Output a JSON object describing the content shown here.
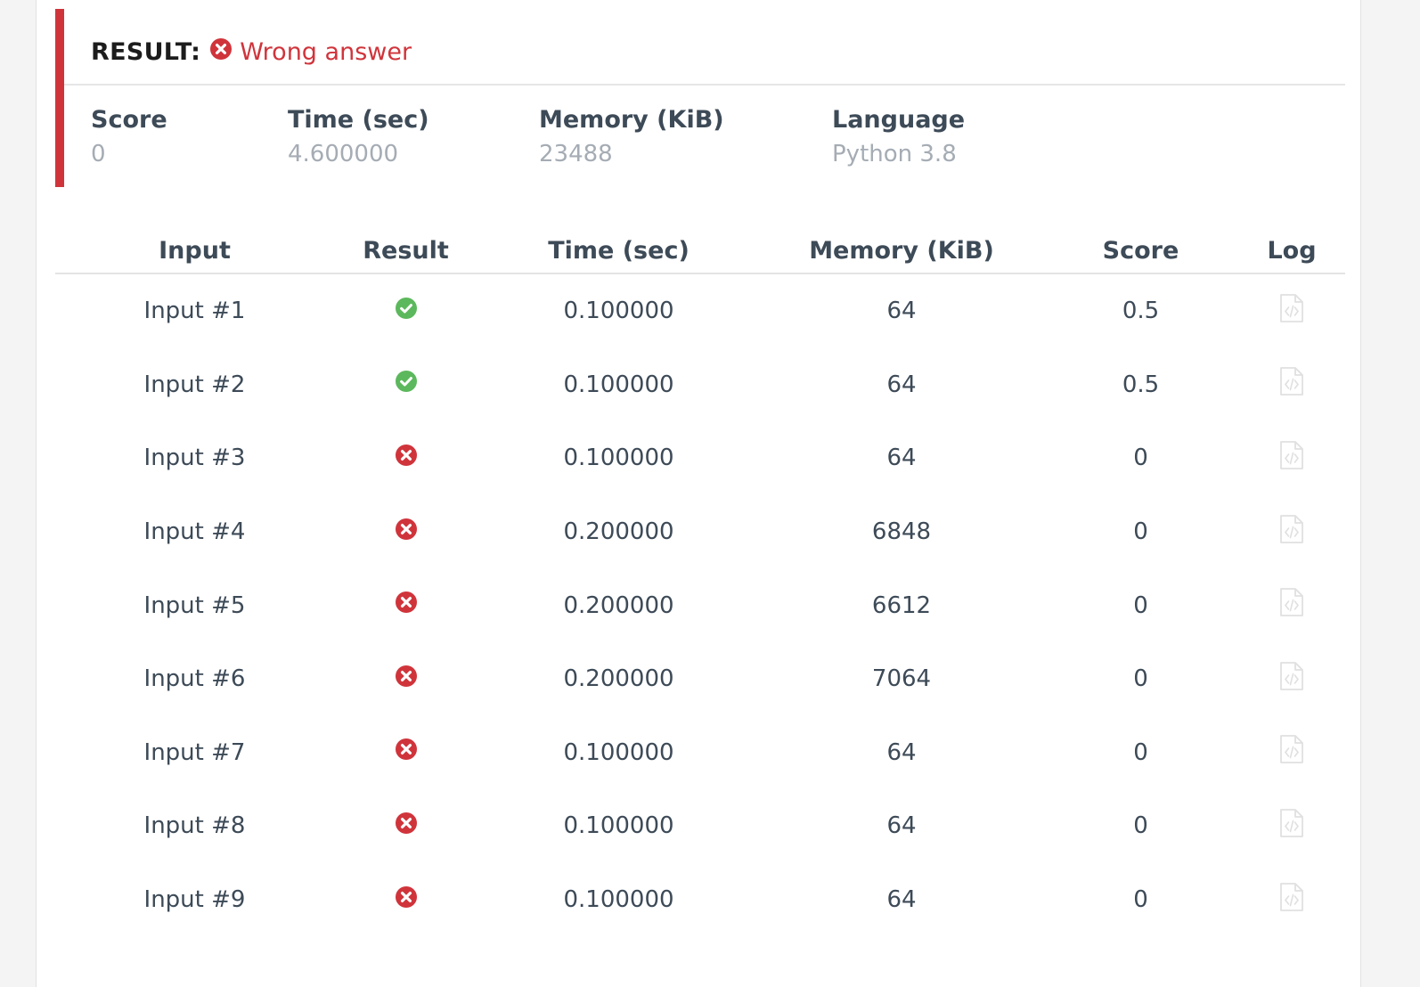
{
  "result": {
    "label": "RESULT:",
    "status_icon": "times-circle-icon",
    "value": "Wrong answer",
    "accent_color": "#d0343b"
  },
  "stats": [
    {
      "label": "Score",
      "value": "0"
    },
    {
      "label": "Time (sec)",
      "value": "4.600000"
    },
    {
      "label": "Memory (KiB)",
      "value": "23488"
    },
    {
      "label": "Language",
      "value": "Python 3.8"
    }
  ],
  "table": {
    "headers": [
      "Input",
      "Result",
      "Time (sec)",
      "Memory (KiB)",
      "Score",
      "Log"
    ],
    "rows": [
      {
        "input": "Input #1",
        "result": "accepted",
        "time": "0.100000",
        "memory": "64",
        "score": "0.5",
        "log_icon": "code-file-icon"
      },
      {
        "input": "Input #2",
        "result": "accepted",
        "time": "0.100000",
        "memory": "64",
        "score": "0.5",
        "log_icon": "code-file-icon"
      },
      {
        "input": "Input #3",
        "result": "wrong",
        "time": "0.100000",
        "memory": "64",
        "score": "0",
        "log_icon": "code-file-icon"
      },
      {
        "input": "Input #4",
        "result": "wrong",
        "time": "0.200000",
        "memory": "6848",
        "score": "0",
        "log_icon": "code-file-icon"
      },
      {
        "input": "Input #5",
        "result": "wrong",
        "time": "0.200000",
        "memory": "6612",
        "score": "0",
        "log_icon": "code-file-icon"
      },
      {
        "input": "Input #6",
        "result": "wrong",
        "time": "0.200000",
        "memory": "7064",
        "score": "0",
        "log_icon": "code-file-icon"
      },
      {
        "input": "Input #7",
        "result": "wrong",
        "time": "0.100000",
        "memory": "64",
        "score": "0",
        "log_icon": "code-file-icon"
      },
      {
        "input": "Input #8",
        "result": "wrong",
        "time": "0.100000",
        "memory": "64",
        "score": "0",
        "log_icon": "code-file-icon"
      },
      {
        "input": "Input #9",
        "result": "wrong",
        "time": "0.100000",
        "memory": "64",
        "score": "0",
        "log_icon": "code-file-icon"
      }
    ]
  },
  "colors": {
    "accepted": "#5cb85c",
    "wrong": "#d0343b",
    "log_icon": "#e0e0e0"
  }
}
